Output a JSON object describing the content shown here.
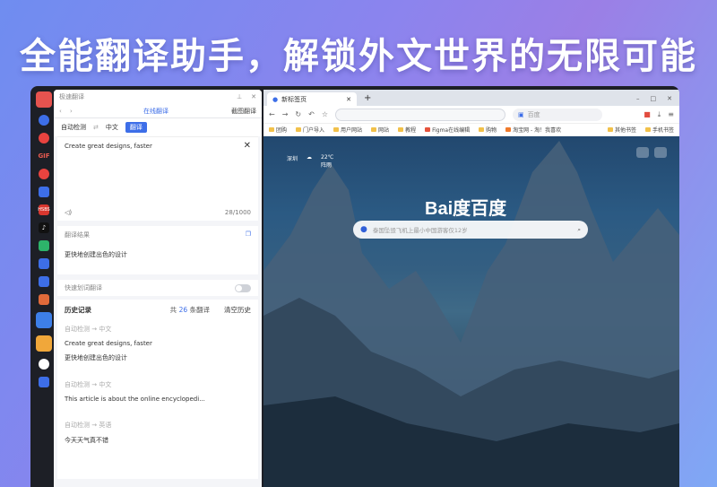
{
  "headline": "全能翻译助手，解锁外文世界的无限可能",
  "appbar": {
    "items": [
      "GIF",
      "HSBS"
    ]
  },
  "panel": {
    "title": "极速翻译",
    "tabs": {
      "online": "在线翻译",
      "screenshot": "截图翻译"
    },
    "lang": {
      "source": "自动检测",
      "swap": "⇄",
      "target": "中文",
      "translate_button": "翻译"
    },
    "input": {
      "text": "Create great designs, faster",
      "count": "28/1000"
    },
    "result": {
      "label": "翻译结果",
      "text": "更快地创建出色的设计"
    },
    "quick": {
      "label": "快速划词翻译"
    },
    "history": {
      "title": "历史记录",
      "count_prefix": "共",
      "count": "26",
      "count_suffix": "条翻译",
      "clear": "清空历史",
      "items": [
        {
          "lang": "自动检测 → 中文",
          "src": "Create great designs, faster",
          "dst": "更快地创建出色的设计"
        },
        {
          "lang": "自动检测 → 中文",
          "src": "This article is about the online encyclopedi...",
          "dst": ""
        },
        {
          "lang": "自动检测 → 英语",
          "src": "今天天气真不错",
          "dst": ""
        }
      ]
    }
  },
  "browser": {
    "tab_title": "新标签页",
    "search_placeholder": "百度",
    "bookmarks": [
      "团购",
      "门户导入",
      "用户网站",
      "网站",
      "教程",
      "Figma在线编辑",
      "购物",
      "淘宝网 - 淘！我喜欢"
    ],
    "bookmarks_right": [
      "其他书签",
      "手机书签"
    ],
    "weather": {
      "city": "深圳",
      "temp": "22℃",
      "desc": "阵雨"
    },
    "logo": "Bai度百度",
    "baidu_search_placeholder": "泰国坠毁飞机上最小中国游客仅12岁"
  },
  "colors": {
    "accent": "#3d6ee8"
  }
}
